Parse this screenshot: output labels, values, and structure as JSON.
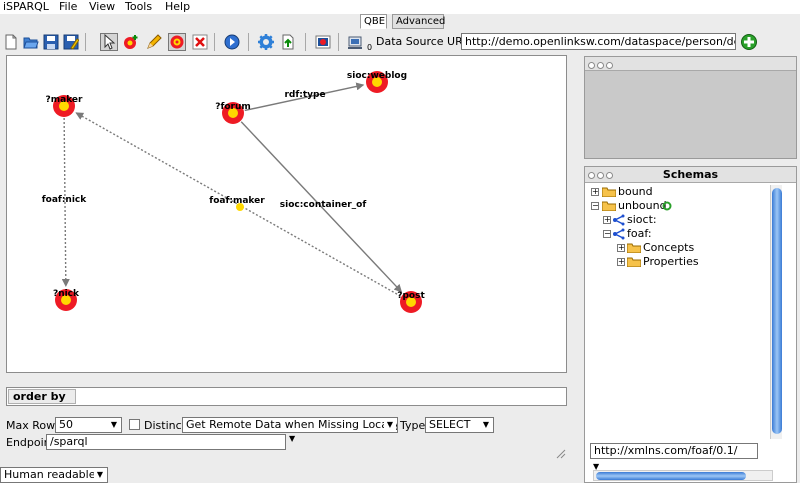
{
  "menu": {
    "app": "iSPARQL",
    "items": [
      "File",
      "View",
      "Tools",
      "Help"
    ]
  },
  "mode_tabs": [
    "QBE",
    "Advanced"
  ],
  "active_tab": "QBE",
  "toolbar": {
    "icons": [
      "new-query-icon",
      "open-icon",
      "save-icon",
      "save-as-icon",
      "pointer-icon",
      "add-node-icon",
      "edit-icon",
      "add-graph-icon",
      "delete-icon",
      "run-query-icon",
      "settings-icon",
      "load-icon",
      "results-icon",
      "data-source-icon"
    ],
    "datasource_subscript": "0",
    "datasource_label": "Data Source URI",
    "datasource_uri": "http://demo.openlinksw.com/dataspace/person/dem"
  },
  "graph": {
    "nodes": [
      {
        "id": "maker",
        "label": "?maker"
      },
      {
        "id": "forum",
        "label": "?forum"
      },
      {
        "id": "weblog",
        "label": "sioc:weblog"
      },
      {
        "id": "nick",
        "label": "?nick"
      },
      {
        "id": "post",
        "label": "?post"
      }
    ],
    "edges": [
      {
        "from": "forum",
        "to": "weblog",
        "label": "rdf:type",
        "style": "solid"
      },
      {
        "from": "forum",
        "to": "post",
        "label": "sioc:container_of",
        "style": "solid"
      },
      {
        "from": "maker",
        "to": "nick",
        "label": "foaf:nick",
        "style": "dotted"
      },
      {
        "from": "post",
        "to": "maker",
        "label": "foaf:maker",
        "style": "dotted"
      }
    ],
    "colors": {
      "node_outer": "#ee1b24",
      "node_inner": "#ffd800",
      "edge": "#7a7a7a"
    }
  },
  "order_by": {
    "label": "order by"
  },
  "options": {
    "max_rows_label": "Max Rows",
    "max_rows": "50",
    "distinct_label": "Distinct",
    "remote": "Get Remote Data when Missing Locally",
    "type_label": "Type",
    "type": "SELECT",
    "endpoint_label": "Endpoint",
    "endpoint": "/sparql"
  },
  "output_format": "Human readable",
  "schemas": {
    "title": "Schemas",
    "tree": [
      {
        "label": "bound",
        "level": 0,
        "expanded": false
      },
      {
        "label": "unbound",
        "level": 0,
        "expanded": true
      },
      {
        "label": "sioct:",
        "level": 1,
        "expanded": false
      },
      {
        "label": "foaf:",
        "level": 1,
        "expanded": true
      },
      {
        "label": "Concepts",
        "level": 2,
        "expanded": false
      },
      {
        "label": "Properties",
        "level": 2,
        "expanded": false
      }
    ],
    "namespace": "http://xmlns.com/foaf/0.1/"
  }
}
